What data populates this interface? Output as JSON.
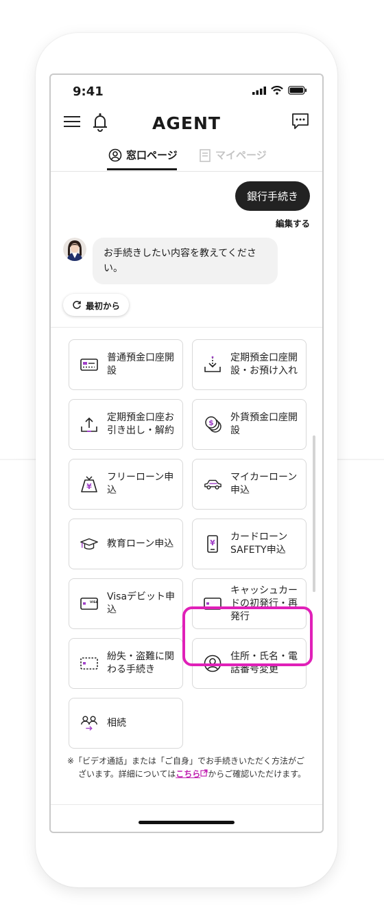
{
  "status": {
    "time": "9:41"
  },
  "header": {
    "logo": "AGENT"
  },
  "tabs": [
    {
      "label": "窓口ページ",
      "active": true
    },
    {
      "label": "マイページ",
      "active": false
    }
  ],
  "chat": {
    "user_message": "銀行手続き",
    "edit_label": "編集する",
    "bot_message": "お手続きしたい内容を教えてください。",
    "restart_label": "最初から"
  },
  "menu": [
    {
      "label": "普通預金口座開設",
      "icon": "bank-card-icon"
    },
    {
      "label": "定期預金口座開設・お預け入れ",
      "icon": "download-icon"
    },
    {
      "label": "定期預金口座お引き出し・解約",
      "icon": "upload-icon"
    },
    {
      "label": "外貨預金口座開設",
      "icon": "coins-icon"
    },
    {
      "label": "フリーローン申込",
      "icon": "money-bag-icon"
    },
    {
      "label": "マイカーローン申込",
      "icon": "car-icon"
    },
    {
      "label": "教育ローン申込",
      "icon": "graduation-cap-icon"
    },
    {
      "label": "カードローンSAFETY申込",
      "icon": "phone-yen-icon",
      "highlighted": true
    },
    {
      "label": "Visaデビット申込",
      "icon": "visa-card-icon"
    },
    {
      "label": "キャッシュカードの初発行・再発行",
      "icon": "cash-card-icon"
    },
    {
      "label": "紛失・盗難に関わる手続き",
      "icon": "lost-card-icon"
    },
    {
      "label": "住所・氏名・電話番号変更",
      "icon": "person-icon"
    },
    {
      "label": "相続",
      "icon": "inheritance-icon"
    }
  ],
  "note": {
    "prefix": "※「ビデオ通話」または「ご自身」でお手続きいただく方法がございます。詳細については",
    "link": "こちら",
    "suffix": "からご確認いただけます。"
  },
  "colors": {
    "accent": "#e020b8",
    "icon_purple": "#a040c8",
    "dark": "#1a1a1a"
  }
}
